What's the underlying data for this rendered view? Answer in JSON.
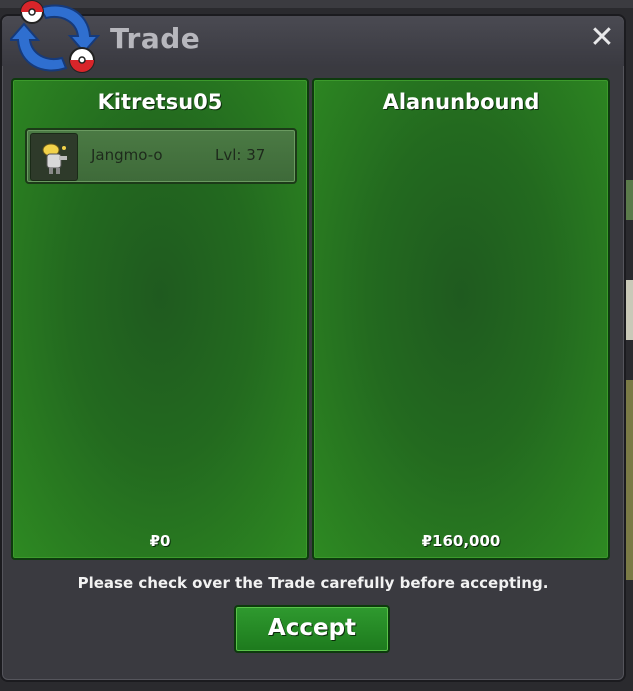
{
  "window": {
    "title": "Trade",
    "close_icon": "close-icon"
  },
  "left_panel": {
    "player": "Kitretsu05",
    "items": [
      {
        "name": "Jangmo-o",
        "level": "Lvl: 37"
      }
    ],
    "money": "₽0"
  },
  "right_panel": {
    "player": "Alanunbound",
    "money": "₽160,000"
  },
  "footer": {
    "notice": "Please check over the Trade carefully before accepting.",
    "accept_label": "Accept"
  },
  "colors": {
    "panel_green": "#236a1f",
    "accept_green": "#1d7a1d",
    "window_bg": "#3a3a40"
  }
}
